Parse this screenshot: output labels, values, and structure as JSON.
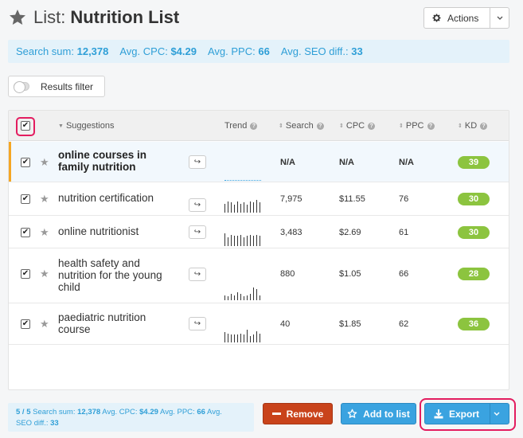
{
  "header": {
    "prefix": "List:",
    "title": "Nutrition List"
  },
  "actions_button": {
    "label": "Actions"
  },
  "summary": {
    "search_label": "Search sum:",
    "search_value": "12,378",
    "cpc_label": "Avg. CPC:",
    "cpc_value": "$4.29",
    "ppc_label": "Avg. PPC:",
    "ppc_value": "66",
    "seo_label": "Avg. SEO diff.:",
    "seo_value": "33"
  },
  "filter": {
    "label": "Results filter",
    "enabled": false
  },
  "table": {
    "headers": {
      "suggestions": "Suggestions",
      "trend": "Trend",
      "search": "Search",
      "cpc": "CPC",
      "ppc": "PPC",
      "kd": "KD"
    },
    "rows": [
      {
        "line1": "online courses in",
        "line2": "family nutrition",
        "line3": "",
        "search": "N/A",
        "cpc": "N/A",
        "ppc": "N/A",
        "kd": "39",
        "selected": true,
        "active": true,
        "trend": []
      },
      {
        "line1": "nutrition certification",
        "line2": "",
        "line3": "",
        "search": "7,975",
        "cpc": "$11.55",
        "ppc": "76",
        "kd": "30",
        "selected": true,
        "active": false,
        "trend": [
          0.7,
          0.9,
          0.8,
          0.6,
          0.9,
          0.7,
          0.8,
          0.6,
          0.9,
          0.8,
          1.0,
          0.8
        ]
      },
      {
        "line1": "online nutritionist",
        "line2": "",
        "line3": "",
        "search": "3,483",
        "cpc": "$2.69",
        "ppc": "61",
        "kd": "30",
        "selected": true,
        "active": false,
        "trend": [
          1.0,
          0.7,
          0.9,
          0.8,
          0.8,
          0.9,
          0.7,
          0.8,
          0.9,
          0.8,
          0.9,
          0.8
        ]
      },
      {
        "line1": "health safety and",
        "line2": "nutrition for the young",
        "line3": "child",
        "search": "880",
        "cpc": "$1.05",
        "ppc": "66",
        "kd": "28",
        "selected": true,
        "active": false,
        "trend": [
          0.4,
          0.3,
          0.5,
          0.4,
          0.6,
          0.5,
          0.3,
          0.4,
          0.5,
          1.0,
          0.9,
          0.4
        ]
      },
      {
        "line1": "paediatric nutrition",
        "line2": "course",
        "line3": "",
        "search": "40",
        "cpc": "$1.85",
        "ppc": "62",
        "kd": "36",
        "selected": true,
        "active": false,
        "trend": [
          0.8,
          0.7,
          0.6,
          0.6,
          0.6,
          0.7,
          0.6,
          1.0,
          0.5,
          0.6,
          0.9,
          0.7
        ]
      }
    ]
  },
  "footer": {
    "count": "5 / 5",
    "search_label": "Search sum:",
    "search_value": "12,378",
    "cpc_label": "Avg. CPC:",
    "cpc_value": "$4.29",
    "ppc_label": "Avg. PPC:",
    "ppc_value": "66",
    "seo_label_1": "Avg.",
    "seo_label_2": "SEO diff.:",
    "seo_value": "33"
  },
  "buttons": {
    "remove": "Remove",
    "add_to_list": "Add to list",
    "export": "Export"
  },
  "colors": {
    "accent": "#3aa3e0",
    "remove": "#c9431b",
    "kd_green": "#8cc43f",
    "highlight": "#e31c5f",
    "active_marker": "#f5a623"
  }
}
